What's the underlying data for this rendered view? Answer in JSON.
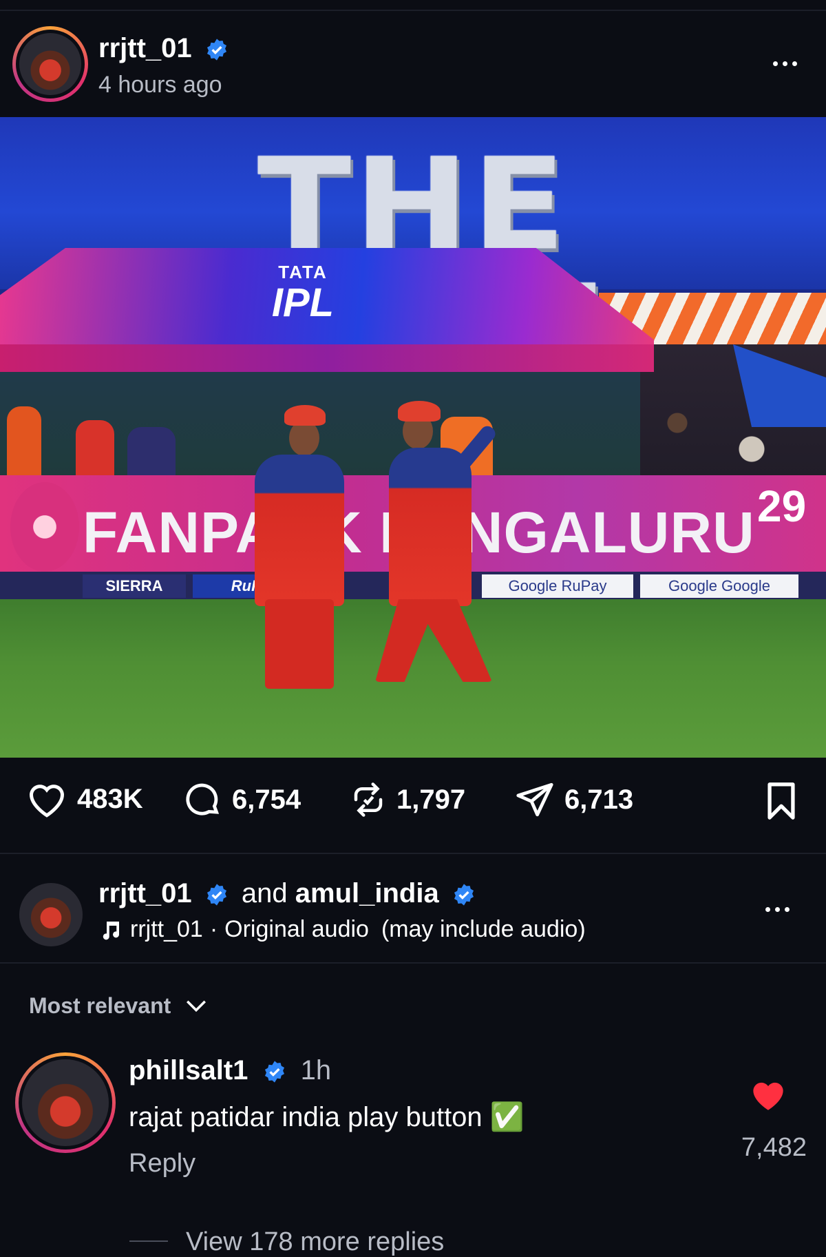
{
  "post": {
    "username": "rrjtt_01",
    "time": "4 hours ago",
    "image": {
      "headline": "THE FINAL",
      "logo_top": "TATA",
      "logo_main": "IPL",
      "board_text": "FANPARK BENGALURU",
      "board_number": "29",
      "sponsors": [
        "SIERRA",
        "RuPay",
        "Google RuPay",
        "Google Google"
      ]
    }
  },
  "actions": {
    "likes": "483K",
    "comments": "6,754",
    "reposts": "1,797",
    "shares": "6,713"
  },
  "collab": {
    "user1": "rrjtt_01",
    "joiner": "and",
    "user2": "amul_india",
    "audio_user": "rrjtt_01",
    "audio_sep": "·",
    "audio_title": "Original audio",
    "audio_note": "(may include audio)"
  },
  "comments_section": {
    "sort_label": "Most relevant",
    "comment": {
      "username": "phillsalt1",
      "time": "1h",
      "text": "rajat patidar india play button ✅",
      "reply_label": "Reply",
      "like_count": "7,482",
      "view_replies": "View 178 more replies"
    }
  },
  "colors": {
    "background": "#0b0d14",
    "verified": "#2f86f6",
    "heart": "#ff3040"
  }
}
